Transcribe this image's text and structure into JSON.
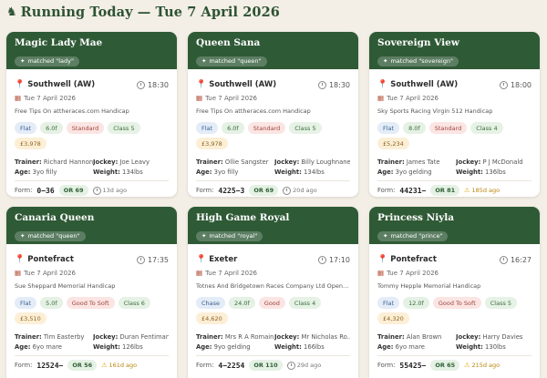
{
  "header": {
    "horse_icon": "horse-icon",
    "title": "Running Today — Tue 7 April 2026"
  },
  "cards": [
    {
      "name": "Magic Lady Mae",
      "matched": "matched \"lady\"",
      "course": "Southwell (AW)",
      "time": "18:30",
      "date": "Tue 7 April 2026",
      "race": "Free Tips On attheraces.com Handicap",
      "tags": [
        "Flat",
        "6.0f",
        "Standard",
        "Class 5",
        "£3,978"
      ],
      "trainer": "Richard Hannon",
      "jockey": "Joe Leavy",
      "age": "3yo filly",
      "weight": "134lbs",
      "form": "0−36",
      "or": "OR 69",
      "ago": "13d ago",
      "stale": false
    },
    {
      "name": "Queen Sana",
      "matched": "matched \"queen\"",
      "course": "Southwell (AW)",
      "time": "18:30",
      "date": "Tue 7 April 2026",
      "race": "Free Tips On attheraces.com Handicap",
      "tags": [
        "Flat",
        "6.0f",
        "Standard",
        "Class 5",
        "£3,978"
      ],
      "trainer": "Ollie Sangster",
      "jockey": "Billy Loughnane",
      "age": "3yo filly",
      "weight": "134lbs",
      "form": "4225−3",
      "or": "OR 69",
      "ago": "20d ago",
      "stale": false
    },
    {
      "name": "Sovereign View",
      "matched": "matched \"sovereign\"",
      "course": "Southwell (AW)",
      "time": "18:00",
      "date": "Tue 7 April 2026",
      "race": "Sky Sports Racing Virgin 512 Handicap",
      "tags": [
        "Flat",
        "8.0f",
        "Standard",
        "Class 4",
        "£5,234"
      ],
      "trainer": "James Tate",
      "jockey": "P J McDonald",
      "age": "3yo gelding",
      "weight": "136lbs",
      "form": "44231−",
      "or": "OR 81",
      "ago": "185d ago",
      "stale": true
    },
    {
      "name": "Canaria Queen",
      "matched": "matched \"queen\"",
      "course": "Pontefract",
      "time": "17:35",
      "date": "Tue 7 April 2026",
      "race": "Sue Sheppard Memorial Handicap",
      "tags": [
        "Flat",
        "5.0f",
        "Good To Soft",
        "Class 6",
        "£3,510"
      ],
      "trainer": "Tim Easterby",
      "jockey": "Duran Fentiman",
      "age": "6yo mare",
      "weight": "126lbs",
      "form": "12524−",
      "or": "OR 56",
      "ago": "161d ago",
      "stale": true
    },
    {
      "name": "High Game Royal",
      "matched": "matched \"royal\"",
      "course": "Exeter",
      "time": "17:10",
      "date": "Tue 7 April 2026",
      "race": "Totnes And Bridgetown Races Company Ltd Open H...",
      "tags": [
        "Chase",
        "24.0f",
        "Good",
        "Class 4",
        "£4,620"
      ],
      "trainer": "Mrs R A Romain",
      "jockey": "Mr Nicholas Ro...",
      "age": "9yo gelding",
      "weight": "166lbs",
      "form": "4−2254",
      "or": "OR 110",
      "ago": "29d ago",
      "stale": false
    },
    {
      "name": "Princess Niyla",
      "matched": "matched \"prince\"",
      "course": "Pontefract",
      "time": "16:27",
      "date": "Tue 7 April 2026",
      "race": "Tommy Hepple Memorial Handicap",
      "tags": [
        "Flat",
        "12.0f",
        "Good To Soft",
        "Class 5",
        "£4,320"
      ],
      "trainer": "Alan Brown",
      "jockey": "Harry Davies",
      "age": "6yo mare",
      "weight": "130lbs",
      "form": "55425−",
      "or": "OR 65",
      "ago": "215d ago",
      "stale": true
    }
  ],
  "labels": {
    "trainer": "Trainer:",
    "jockey": "Jockey:",
    "age": "Age:",
    "weight": "Weight:",
    "form": "Form:"
  }
}
